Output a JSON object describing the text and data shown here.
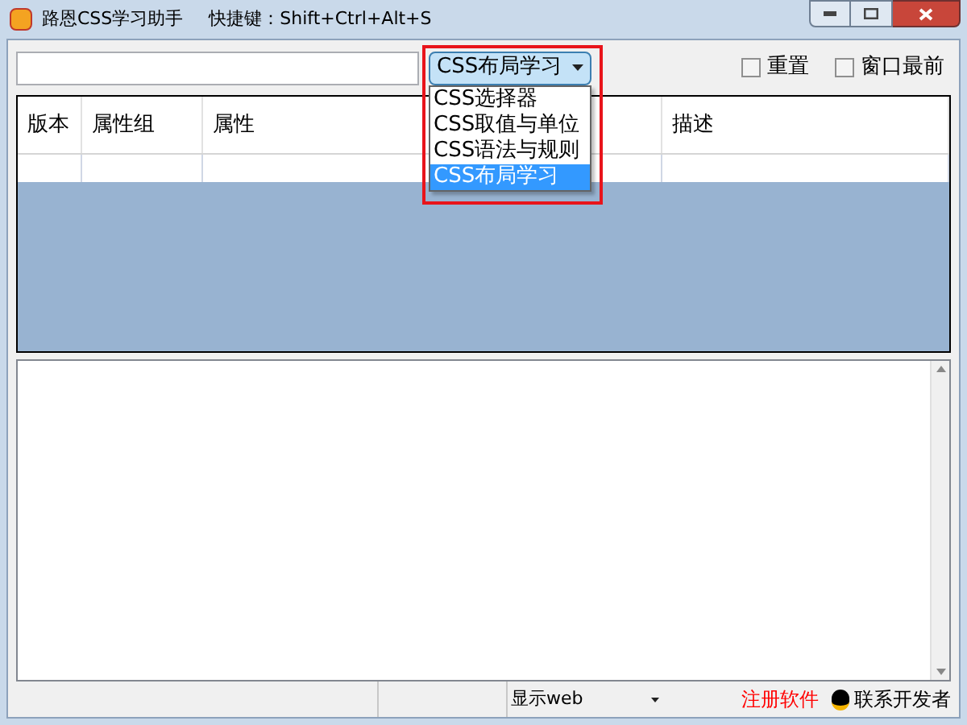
{
  "window": {
    "title": "路恩CSS学习助手",
    "shortcut": "快捷键：Shift+Ctrl+Alt+S"
  },
  "category_combo": {
    "value": "CSS布局学习",
    "expanded": true,
    "options": [
      {
        "label": "CSS选择器",
        "selected": false
      },
      {
        "label": "CSS取值与单位",
        "selected": false
      },
      {
        "label": "CSS语法与规则",
        "selected": false
      },
      {
        "label": "CSS布局学习",
        "selected": true
      }
    ]
  },
  "checkboxes": [
    {
      "label": "重置",
      "checked": false
    },
    {
      "label": "窗口最前",
      "checked": false
    }
  ],
  "table": {
    "columns": [
      "版本",
      "属性组",
      "属性",
      "描述"
    ]
  },
  "status_bar": {
    "display_combo": "显示web",
    "register_link": "注册软件",
    "contact_link": "联系开发者"
  }
}
